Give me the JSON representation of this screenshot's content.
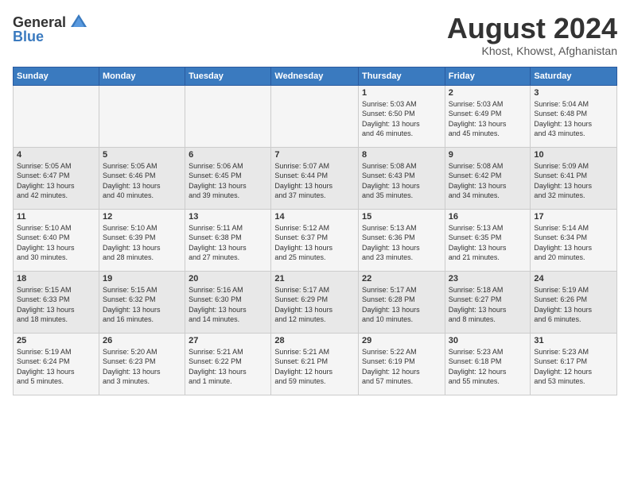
{
  "logo": {
    "general": "General",
    "blue": "Blue"
  },
  "title": "August 2024",
  "location": "Khost, Khowst, Afghanistan",
  "weekdays": [
    "Sunday",
    "Monday",
    "Tuesday",
    "Wednesday",
    "Thursday",
    "Friday",
    "Saturday"
  ],
  "weeks": [
    [
      {
        "day": "",
        "info": ""
      },
      {
        "day": "",
        "info": ""
      },
      {
        "day": "",
        "info": ""
      },
      {
        "day": "",
        "info": ""
      },
      {
        "day": "1",
        "info": "Sunrise: 5:03 AM\nSunset: 6:50 PM\nDaylight: 13 hours\nand 46 minutes."
      },
      {
        "day": "2",
        "info": "Sunrise: 5:03 AM\nSunset: 6:49 PM\nDaylight: 13 hours\nand 45 minutes."
      },
      {
        "day": "3",
        "info": "Sunrise: 5:04 AM\nSunset: 6:48 PM\nDaylight: 13 hours\nand 43 minutes."
      }
    ],
    [
      {
        "day": "4",
        "info": "Sunrise: 5:05 AM\nSunset: 6:47 PM\nDaylight: 13 hours\nand 42 minutes."
      },
      {
        "day": "5",
        "info": "Sunrise: 5:05 AM\nSunset: 6:46 PM\nDaylight: 13 hours\nand 40 minutes."
      },
      {
        "day": "6",
        "info": "Sunrise: 5:06 AM\nSunset: 6:45 PM\nDaylight: 13 hours\nand 39 minutes."
      },
      {
        "day": "7",
        "info": "Sunrise: 5:07 AM\nSunset: 6:44 PM\nDaylight: 13 hours\nand 37 minutes."
      },
      {
        "day": "8",
        "info": "Sunrise: 5:08 AM\nSunset: 6:43 PM\nDaylight: 13 hours\nand 35 minutes."
      },
      {
        "day": "9",
        "info": "Sunrise: 5:08 AM\nSunset: 6:42 PM\nDaylight: 13 hours\nand 34 minutes."
      },
      {
        "day": "10",
        "info": "Sunrise: 5:09 AM\nSunset: 6:41 PM\nDaylight: 13 hours\nand 32 minutes."
      }
    ],
    [
      {
        "day": "11",
        "info": "Sunrise: 5:10 AM\nSunset: 6:40 PM\nDaylight: 13 hours\nand 30 minutes."
      },
      {
        "day": "12",
        "info": "Sunrise: 5:10 AM\nSunset: 6:39 PM\nDaylight: 13 hours\nand 28 minutes."
      },
      {
        "day": "13",
        "info": "Sunrise: 5:11 AM\nSunset: 6:38 PM\nDaylight: 13 hours\nand 27 minutes."
      },
      {
        "day": "14",
        "info": "Sunrise: 5:12 AM\nSunset: 6:37 PM\nDaylight: 13 hours\nand 25 minutes."
      },
      {
        "day": "15",
        "info": "Sunrise: 5:13 AM\nSunset: 6:36 PM\nDaylight: 13 hours\nand 23 minutes."
      },
      {
        "day": "16",
        "info": "Sunrise: 5:13 AM\nSunset: 6:35 PM\nDaylight: 13 hours\nand 21 minutes."
      },
      {
        "day": "17",
        "info": "Sunrise: 5:14 AM\nSunset: 6:34 PM\nDaylight: 13 hours\nand 20 minutes."
      }
    ],
    [
      {
        "day": "18",
        "info": "Sunrise: 5:15 AM\nSunset: 6:33 PM\nDaylight: 13 hours\nand 18 minutes."
      },
      {
        "day": "19",
        "info": "Sunrise: 5:15 AM\nSunset: 6:32 PM\nDaylight: 13 hours\nand 16 minutes."
      },
      {
        "day": "20",
        "info": "Sunrise: 5:16 AM\nSunset: 6:30 PM\nDaylight: 13 hours\nand 14 minutes."
      },
      {
        "day": "21",
        "info": "Sunrise: 5:17 AM\nSunset: 6:29 PM\nDaylight: 13 hours\nand 12 minutes."
      },
      {
        "day": "22",
        "info": "Sunrise: 5:17 AM\nSunset: 6:28 PM\nDaylight: 13 hours\nand 10 minutes."
      },
      {
        "day": "23",
        "info": "Sunrise: 5:18 AM\nSunset: 6:27 PM\nDaylight: 13 hours\nand 8 minutes."
      },
      {
        "day": "24",
        "info": "Sunrise: 5:19 AM\nSunset: 6:26 PM\nDaylight: 13 hours\nand 6 minutes."
      }
    ],
    [
      {
        "day": "25",
        "info": "Sunrise: 5:19 AM\nSunset: 6:24 PM\nDaylight: 13 hours\nand 5 minutes."
      },
      {
        "day": "26",
        "info": "Sunrise: 5:20 AM\nSunset: 6:23 PM\nDaylight: 13 hours\nand 3 minutes."
      },
      {
        "day": "27",
        "info": "Sunrise: 5:21 AM\nSunset: 6:22 PM\nDaylight: 13 hours\nand 1 minute."
      },
      {
        "day": "28",
        "info": "Sunrise: 5:21 AM\nSunset: 6:21 PM\nDaylight: 12 hours\nand 59 minutes."
      },
      {
        "day": "29",
        "info": "Sunrise: 5:22 AM\nSunset: 6:19 PM\nDaylight: 12 hours\nand 57 minutes."
      },
      {
        "day": "30",
        "info": "Sunrise: 5:23 AM\nSunset: 6:18 PM\nDaylight: 12 hours\nand 55 minutes."
      },
      {
        "day": "31",
        "info": "Sunrise: 5:23 AM\nSunset: 6:17 PM\nDaylight: 12 hours\nand 53 minutes."
      }
    ]
  ]
}
